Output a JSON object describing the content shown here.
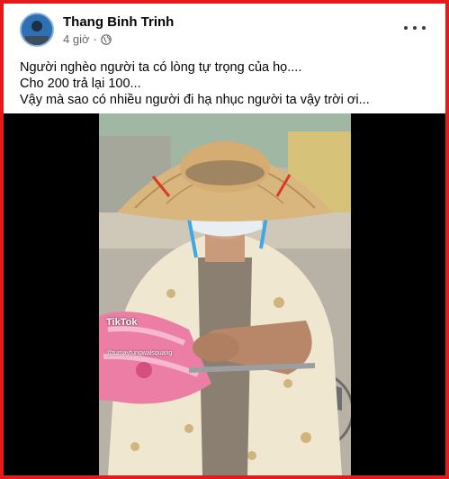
{
  "post": {
    "author": "Thang Binh Trinh",
    "time": "4 giờ",
    "separator": "·",
    "lines": [
      "Người nghèo người ta có lòng tự trọng của họ....",
      "Cho 200 trả lại 100...",
      "Vậy mà sao có nhiều người đi hạ nhục người ta vậy trời ơi..."
    ]
  },
  "video": {
    "watermark": "TikTok",
    "username": "@tumayfungwalsquang"
  },
  "icons": {
    "privacy": "globe-icon",
    "menu": "more-options-icon"
  },
  "colors": {
    "highlight_border": "#e41b1b",
    "author_text": "#050505",
    "meta_text": "#65676b"
  }
}
